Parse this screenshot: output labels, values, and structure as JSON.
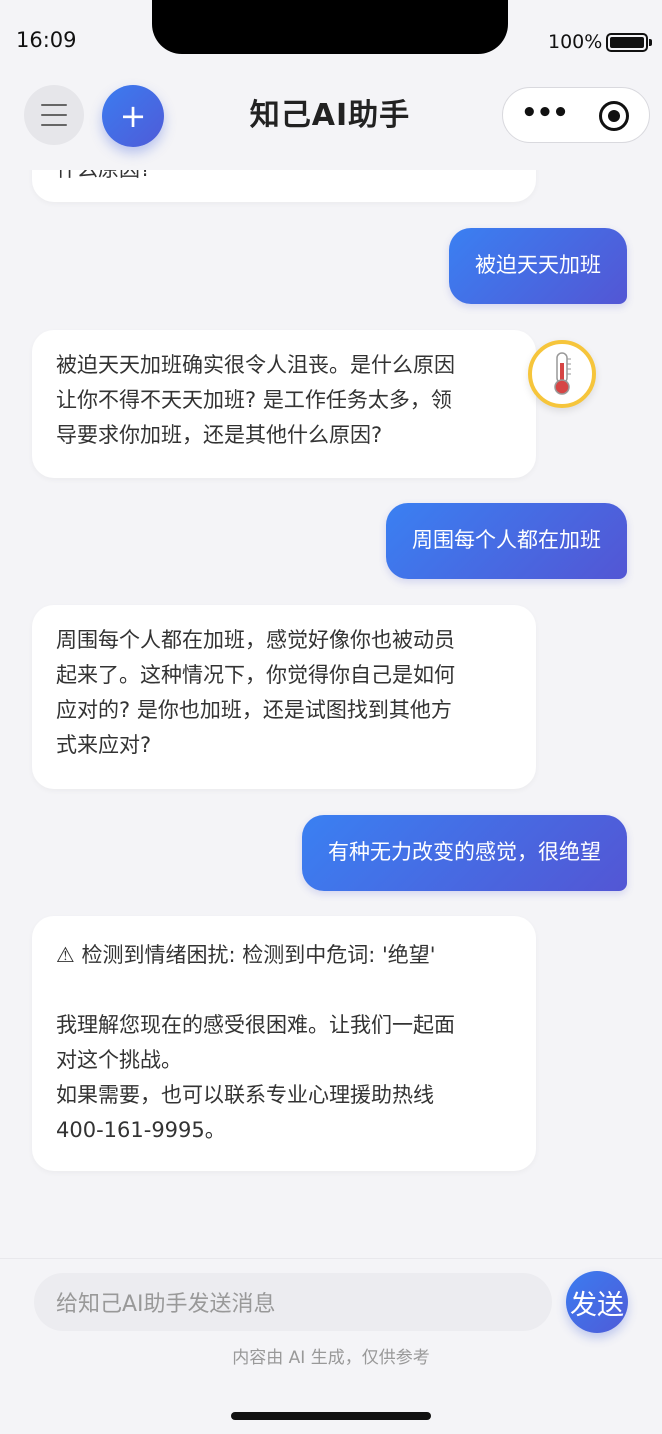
{
  "status_bar": {
    "time": "16:09",
    "battery": "100%"
  },
  "nav": {
    "title": "知己AI助手",
    "new_chat_symbol": "+",
    "menu_icon": "hamburger-menu-icon",
    "more_icon": "more-dots-icon",
    "close_icon": "target-close-icon",
    "more_dots": "•••"
  },
  "messages": [
    {
      "role": "ai",
      "text": "什么原因?"
    },
    {
      "role": "user",
      "text": "被迫天天加班"
    },
    {
      "role": "ai",
      "lines": [
        "被迫天天加班确实很令人沮丧。是什么原因",
        "让你不得不天天加班? 是工作任务太多，领",
        "导要求你加班，还是其他什么原因?"
      ],
      "emotion_icon": "thermometer-icon"
    },
    {
      "role": "user",
      "text": "周围每个人都在加班"
    },
    {
      "role": "ai",
      "lines": [
        "周围每个人都在加班，感觉好像你也被动员",
        "起来了。这种情况下，你觉得你自己是如何",
        "应对的? 是你也加班，还是试图找到其他方",
        "式来应对?"
      ]
    },
    {
      "role": "user",
      "text": "有种无力改变的感觉，很绝望"
    },
    {
      "role": "ai",
      "warning": "⚠ 检测到情绪困扰: 检测到中危词: '绝望'",
      "lines": [
        "我理解您现在的感受很困难。让我们一起面",
        "对这个挑战。",
        "如果需要，也可以联系专业心理援助热线",
        "400-161-9995。"
      ]
    }
  ],
  "input": {
    "placeholder": "给知己AI助手发送消息",
    "send_label": "发送"
  },
  "footer": {
    "disclaimer": "内容由 AI 生成，仅供参考"
  },
  "colors": {
    "accent_start": "#3a80f2",
    "accent_end": "#5356d4",
    "background": "#f4f4f7",
    "thermo_ring": "#f6c53b"
  }
}
